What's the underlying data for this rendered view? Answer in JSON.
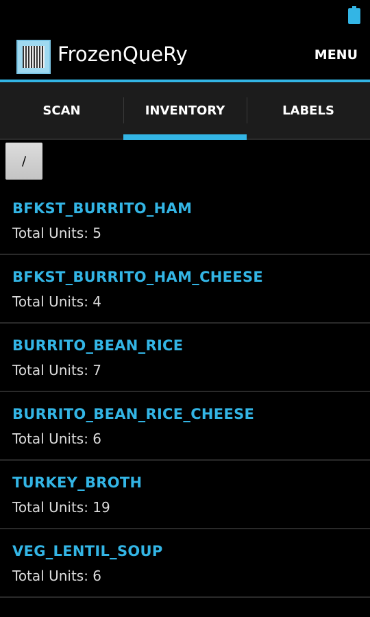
{
  "app": {
    "title": "FrozenQueRy",
    "menu_label": "MENU"
  },
  "tabs": [
    {
      "label": "SCAN"
    },
    {
      "label": "INVENTORY"
    },
    {
      "label": "LABELS"
    }
  ],
  "active_tab": "INVENTORY",
  "path_button": {
    "label": "/"
  },
  "accent_color": "#33b5e5",
  "items": [
    {
      "name": "BFKST_BURRITO_HAM",
      "units": "Total Units: 5"
    },
    {
      "name": "BFKST_BURRITO_HAM_CHEESE",
      "units": "Total Units: 4"
    },
    {
      "name": "BURRITO_BEAN_RICE",
      "units": "Total Units: 7"
    },
    {
      "name": "BURRITO_BEAN_RICE_CHEESE",
      "units": "Total Units: 6"
    },
    {
      "name": "TURKEY_BROTH",
      "units": "Total Units: 19"
    },
    {
      "name": "VEG_LENTIL_SOUP",
      "units": "Total Units: 6"
    }
  ]
}
